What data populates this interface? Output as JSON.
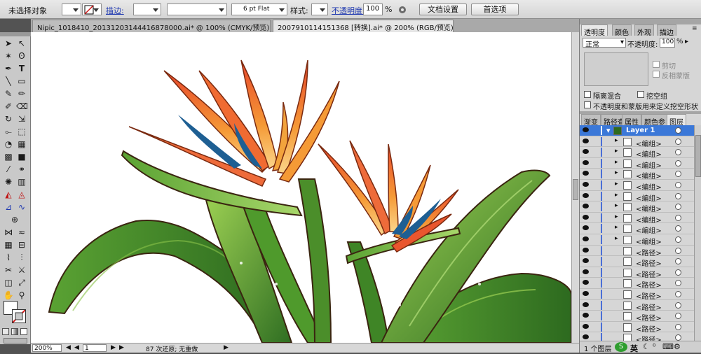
{
  "control_bar": {
    "selection_status": "未选择对象",
    "stroke_label": "描边:",
    "brush_value": "6 pt Flat",
    "style_label": "样式:",
    "opacity_label": "不透明度:",
    "opacity_value": "100",
    "opacity_unit": "%",
    "doc_setup_button": "文档设置",
    "prefs_button": "首选项"
  },
  "doc_tabs": [
    {
      "label": "Nipic_1018410_20131203144416878000.ai* @ 100% (CMYK/预览)",
      "active": false
    },
    {
      "label": "20079101141513​68 [转换].ai* @ 200% (RGB/预览)",
      "active": true
    }
  ],
  "status_bar": {
    "zoom": "200%",
    "artboard": "1",
    "undo_info": "87 次还原; 无重做"
  },
  "transparency_panel": {
    "tabs": [
      "透明度",
      "颜色",
      "外观",
      "描边"
    ],
    "blend_mode": "正常",
    "opacity_label": "不透明度:",
    "opacity_value": "100",
    "opacity_unit": "%",
    "clip_label": "剪切",
    "invert_mask_label": "反相蒙版",
    "isolate_blend_label": "隔离混合",
    "knockout_group_label": "挖空组",
    "opacity_mask_label": "不透明度和蒙版用来定义挖空形状"
  },
  "layers_panel": {
    "tabs": [
      "渐变",
      "路径查",
      "属性",
      "颜色参",
      "图层"
    ],
    "layer_name": "Layer 1",
    "rows": [
      "<编组>",
      "<编组>",
      "<编组>",
      "<编组>",
      "<编组>",
      "<编组>",
      "<编组>",
      "<编组>",
      "<编组>",
      "<编组>",
      "<路径>",
      "<路径>",
      "<路径>",
      "<路径>",
      "<路径>",
      "<路径>",
      "<路径>",
      "<路径>",
      "<路径>",
      "<路径>"
    ],
    "footer_count": "1 个图层",
    "ime_label": "英"
  },
  "colors": {
    "accent": "#3b78d8",
    "leaf_dark": "#3d7a27",
    "leaf_light": "#8bc34a",
    "petal_orange": "#f28a2e",
    "petal_red": "#e0452b",
    "petal_blue": "#1e5f93"
  }
}
